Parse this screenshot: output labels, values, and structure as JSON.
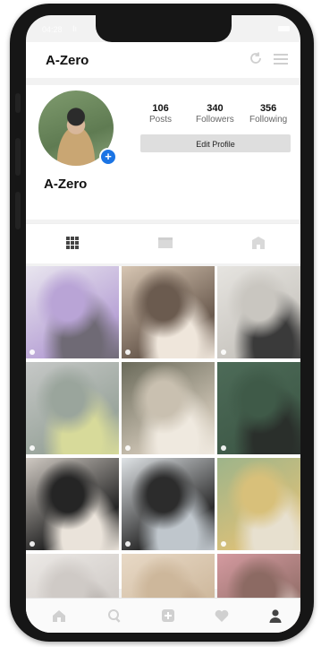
{
  "status": {
    "time": "04:28",
    "signal": "Iı"
  },
  "header": {
    "title": "A-Zero"
  },
  "profile": {
    "name": "A-Zero",
    "posts": {
      "num": "106",
      "label": "Posts"
    },
    "followers": {
      "num": "340",
      "label": "Followers"
    },
    "following": {
      "num": "356",
      "label": "Following"
    },
    "edit_label": "Edit Profile"
  },
  "tabs": [
    "grid-icon",
    "list-icon",
    "tagged-icon"
  ],
  "grid": {
    "posts": [
      {
        "colors": [
          "#e9e6ef",
          "#b9a4d6",
          "#6f6a75"
        ]
      },
      {
        "colors": [
          "#d7c6b3",
          "#6b5b4f",
          "#efe6db"
        ]
      },
      {
        "colors": [
          "#e6e4e0",
          "#c9c6c0",
          "#3a3a3a"
        ]
      },
      {
        "colors": [
          "#c6c8c7",
          "#9aa59c",
          "#d7da9a"
        ]
      },
      {
        "colors": [
          "#6a6a5a",
          "#c9c0b0",
          "#efe9df"
        ]
      },
      {
        "colors": [
          "#4d6b58",
          "#3f5a48",
          "#2a2f2b"
        ]
      },
      {
        "colors": [
          "#cfc9c2",
          "#252525",
          "#eae3da"
        ]
      },
      {
        "colors": [
          "#dfe3e6",
          "#2c2c2c",
          "#bfc6cc"
        ]
      },
      {
        "colors": [
          "#9db48a",
          "#d8c07a",
          "#e7e0cf"
        ]
      },
      {
        "colors": [
          "#ece9e6",
          "#cfcac6",
          "#a7a19d"
        ]
      },
      {
        "colors": [
          "#e8d9c6",
          "#cdb79b",
          "#b99c80"
        ]
      },
      {
        "colors": [
          "#d49aa0",
          "#8c6a63",
          "#f0e3dd"
        ]
      }
    ]
  },
  "bottom_nav": [
    "home-icon",
    "search-icon",
    "add-post-icon",
    "heart-icon",
    "profile-icon"
  ]
}
